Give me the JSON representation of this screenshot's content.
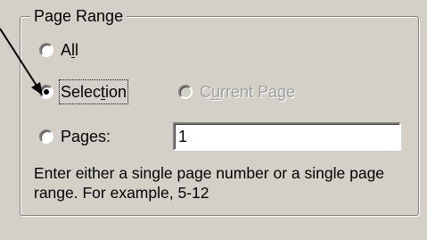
{
  "page_range": {
    "legend": "Page Range",
    "options": {
      "all": {
        "prefix": "A",
        "accel": "l",
        "suffix": "l",
        "selected": false
      },
      "selection": {
        "prefix": "Selec",
        "accel": "t",
        "suffix": "ion",
        "selected": true
      },
      "current_page": {
        "prefix": "C",
        "accel": "u",
        "suffix": "rrent Page",
        "selected": false,
        "enabled": false
      },
      "pages": {
        "prefix": "Pa",
        "accel": "g",
        "suffix": "es:",
        "selected": false
      }
    },
    "pages_value": "1",
    "help_text": "Enter either a single page number or a single page range.  For example, 5-12"
  }
}
